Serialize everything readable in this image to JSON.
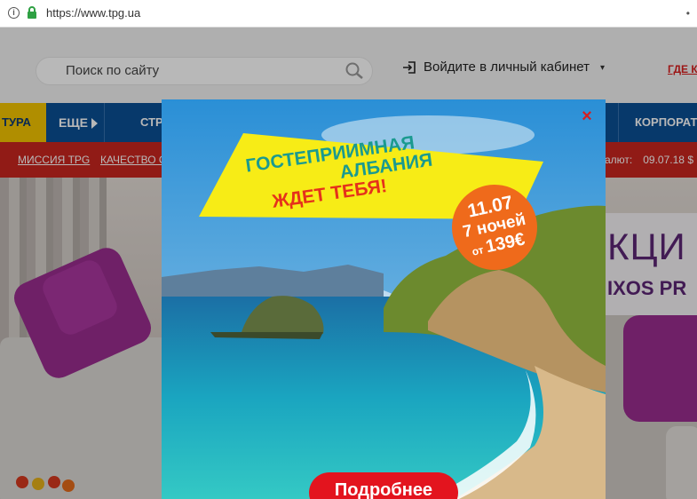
{
  "browser": {
    "url": "https://www.tpg.ua",
    "info_glyph": "i",
    "menu_glyph": "•"
  },
  "header": {
    "search_placeholder": "Поиск по сайту",
    "login_label": "Войдите в личный кабинет",
    "login_caret": "▾",
    "where_label": "ГДЕ КУ"
  },
  "nav": {
    "tura": "ТУРА",
    "more": "ЕЩЕ",
    "countries": "СТРА",
    "corporate": "КОРПОРАТИВ"
  },
  "redbar": {
    "mission": "МИССИЯ TPG",
    "quality": "КАЧЕСТВО ОБ",
    "currency_label": "алют:",
    "date": "09.07.18",
    "currency_sign": "$"
  },
  "hero": {
    "title_part": "КЦИ",
    "subtitle_part": "IXOS PR"
  },
  "popup": {
    "close_glyph": "×",
    "title_line1": "ГОСТЕПРИИМНАЯ",
    "title_line2": "АЛБАНИЯ",
    "title_line3": "ЖДЕТ ТЕБЯ!",
    "badge_date": "11.07",
    "badge_nights": "7 ночей",
    "badge_from": "от",
    "badge_price": "139€",
    "cta_label": "Подробнее"
  },
  "colors": {
    "nav_blue": "#0a4f95",
    "red_bar": "#c9261f",
    "tura_yellow": "#f4c500",
    "cta_red": "#e3141e",
    "badge_orange": "#ef6a1b",
    "banner_yellow": "#f7ec16"
  },
  "icons": [
    "info-icon",
    "lock-icon",
    "search-icon",
    "login-icon",
    "close-icon",
    "arrow-right-icon"
  ]
}
